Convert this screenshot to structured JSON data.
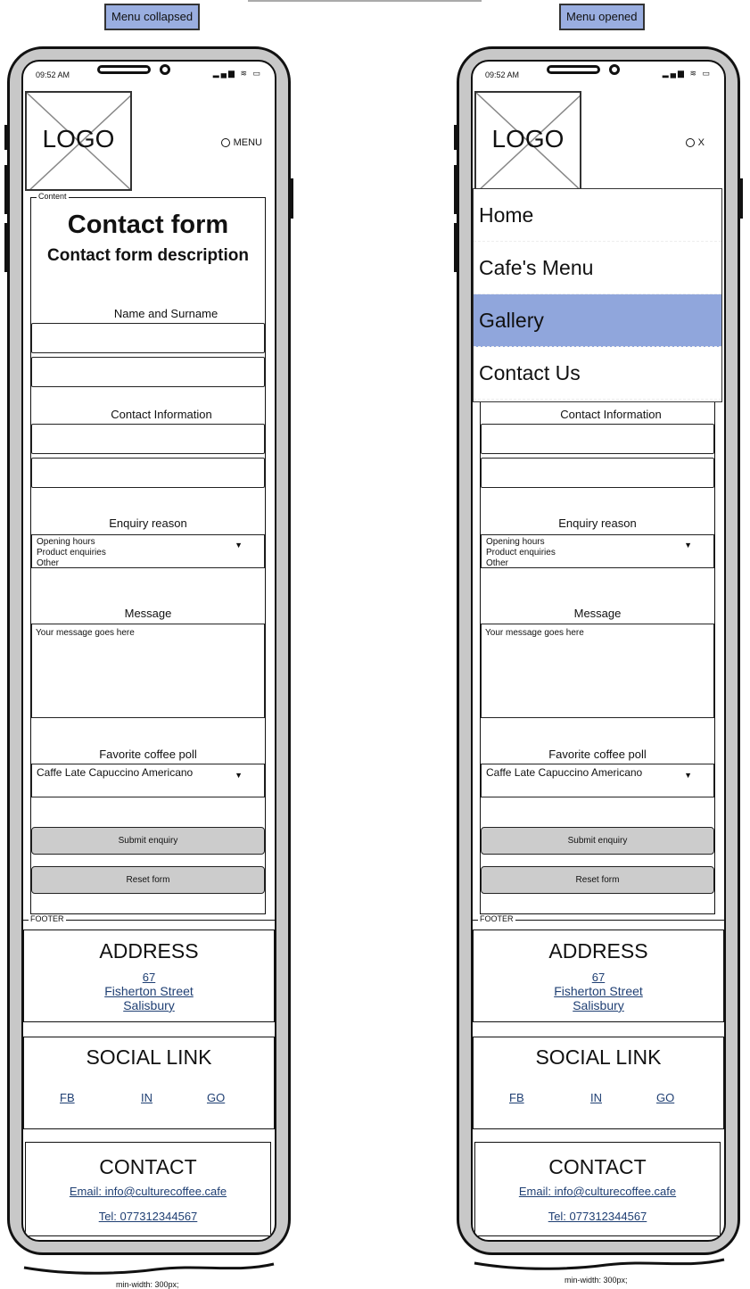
{
  "labels": {
    "left": "Menu collapsed",
    "right": "Menu opened",
    "min_width_left": "min-width: 300px;",
    "min_width_right": "min-width: 300px;"
  },
  "status": {
    "time": "09:52 AM",
    "icons": "▂▄▆ ≋ ▭"
  },
  "header": {
    "logo": "LOGO",
    "menu_collapsed": "MENU",
    "menu_opened": "X"
  },
  "nav": {
    "items": [
      {
        "label": "Home",
        "active": false
      },
      {
        "label": "Cafe's Menu",
        "active": false
      },
      {
        "label": "Gallery",
        "active": true
      },
      {
        "label": "Contact Us",
        "active": false
      }
    ],
    "active_color": "#90a6dc"
  },
  "content": {
    "legend": "Content",
    "title": "Contact form",
    "description": "Contact form description",
    "name_label": "Name and Surname",
    "contact_label": "Contact Information",
    "enquiry_label": "Enquiry reason",
    "enquiry_options": [
      "Opening hours",
      "Product enquiries",
      "Other"
    ],
    "message_label": "Message",
    "message_placeholder": "Your message goes here",
    "poll_label": "Favorite coffee poll",
    "poll_options": [
      "Caffe Late",
      "Capuccino",
      "Americano"
    ],
    "submit": "Submit enquiry",
    "reset": "Reset form"
  },
  "footer": {
    "legend": "FOOTER",
    "address_title": "ADDRESS",
    "address_lines": [
      "67",
      "Fisherton Street",
      "Salisbury"
    ],
    "social_title": "SOCIAL LINK",
    "social_links": [
      "FB",
      "IN",
      "GO"
    ],
    "contact_title": "CONTACT",
    "email": "Email: info@culturecoffee.cafe",
    "tel": "Tel: 077312344567"
  },
  "colors": {
    "label_bg": "#9aaee0",
    "button_bg": "#cccccc",
    "link": "#1f3f73",
    "frame": "#c8c8c8"
  }
}
